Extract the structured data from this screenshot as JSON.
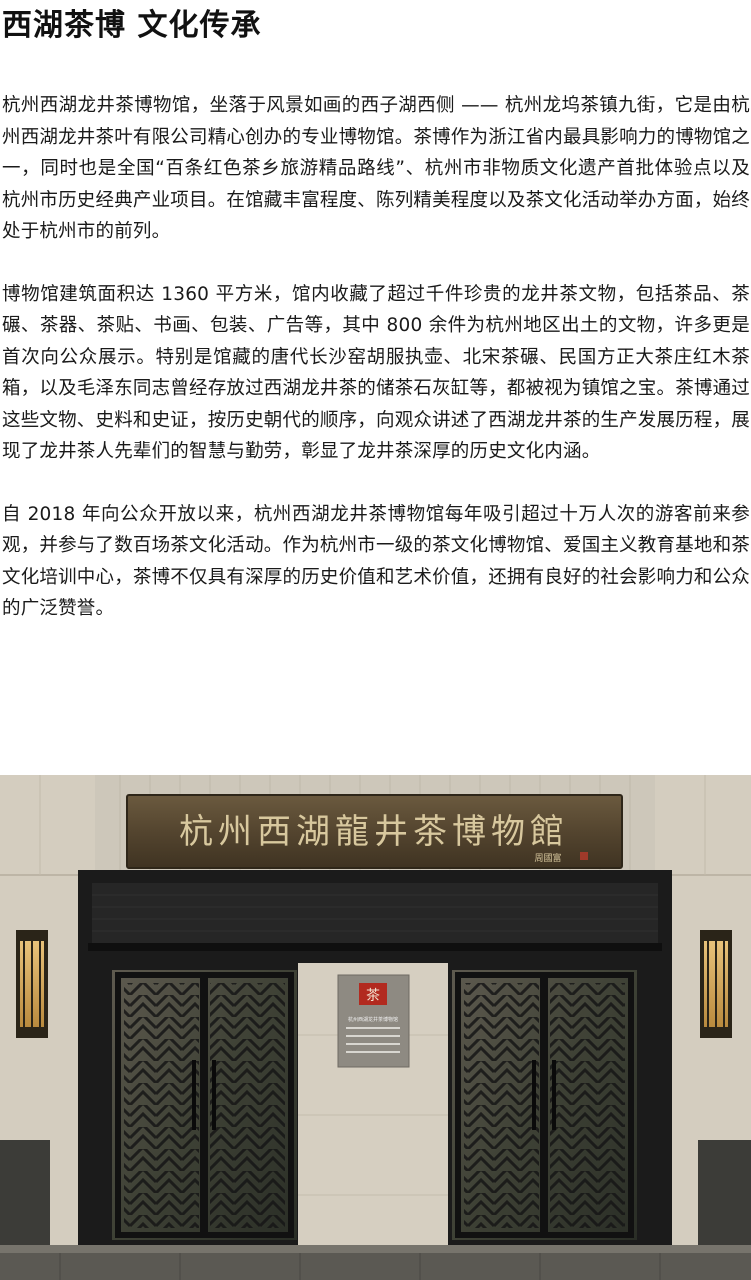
{
  "page": {
    "title": "西湖茶博 文化传承"
  },
  "article": {
    "paragraphs": [
      "杭州西湖龙井茶博物馆，坐落于风景如画的西子湖西侧 —— 杭州龙坞茶镇九街，它是由杭州西湖龙井茶叶有限公司精心创办的专业博物馆。茶博作为浙江省内最具影响力的博物馆之一，同时也是全国“百条红色茶乡旅游精品路线”、杭州市非物质文化遗产首批体验点以及杭州市历史经典产业项目。在馆藏丰富程度、陈列精美程度以及茶文化活动举办方面，始终处于杭州市的前列。",
      "博物馆建筑面积达 1360 平方米，馆内收藏了超过千件珍贵的龙井茶文物，包括茶品、茶碾、茶器、茶贴、书画、包装、广告等，其中 800 余件为杭州地区出土的文物，许多更是首次向公众展示。特别是馆藏的唐代长沙窑胡服执壶、北宋茶碾、民国方正大茶庄红木茶箱，以及毛泽东同志曾经存放过西湖龙井茶的储茶石灰缸等，都被视为镇馆之宝。茶博通过这些文物、史料和史证，按历史朝代的顺序，向观众讲述了西湖龙井茶的生产发展历程，展现了龙井茶人先辈们的智慧与勤劳，彰显了龙井茶深厚的历史文化内涵。",
      "自 2018 年向公众开放以来，杭州西湖龙井茶博物馆每年吸引超过十万人次的游客前来参观，并参与了数百场茶文化活动。作为杭州市一级的茶文化博物馆、爱国主义教育基地和茶文化培训中心，茶博不仅具有深厚的历史价值和艺术价值，还拥有良好的社会影响力和公众的广泛赞誉。"
    ]
  },
  "photo": {
    "signboard_text": "杭州西湖龍井茶博物館",
    "signboard_signature": "周國富",
    "plaque_text": "杭州西湖龙井茶博物馆"
  },
  "colors": {
    "text": "#1a1a1a",
    "frame": "#1b1b1b",
    "sign_wood": "#5a4a33",
    "sign_gold": "#d8c89e",
    "plaque_red": "#b22a1f"
  }
}
